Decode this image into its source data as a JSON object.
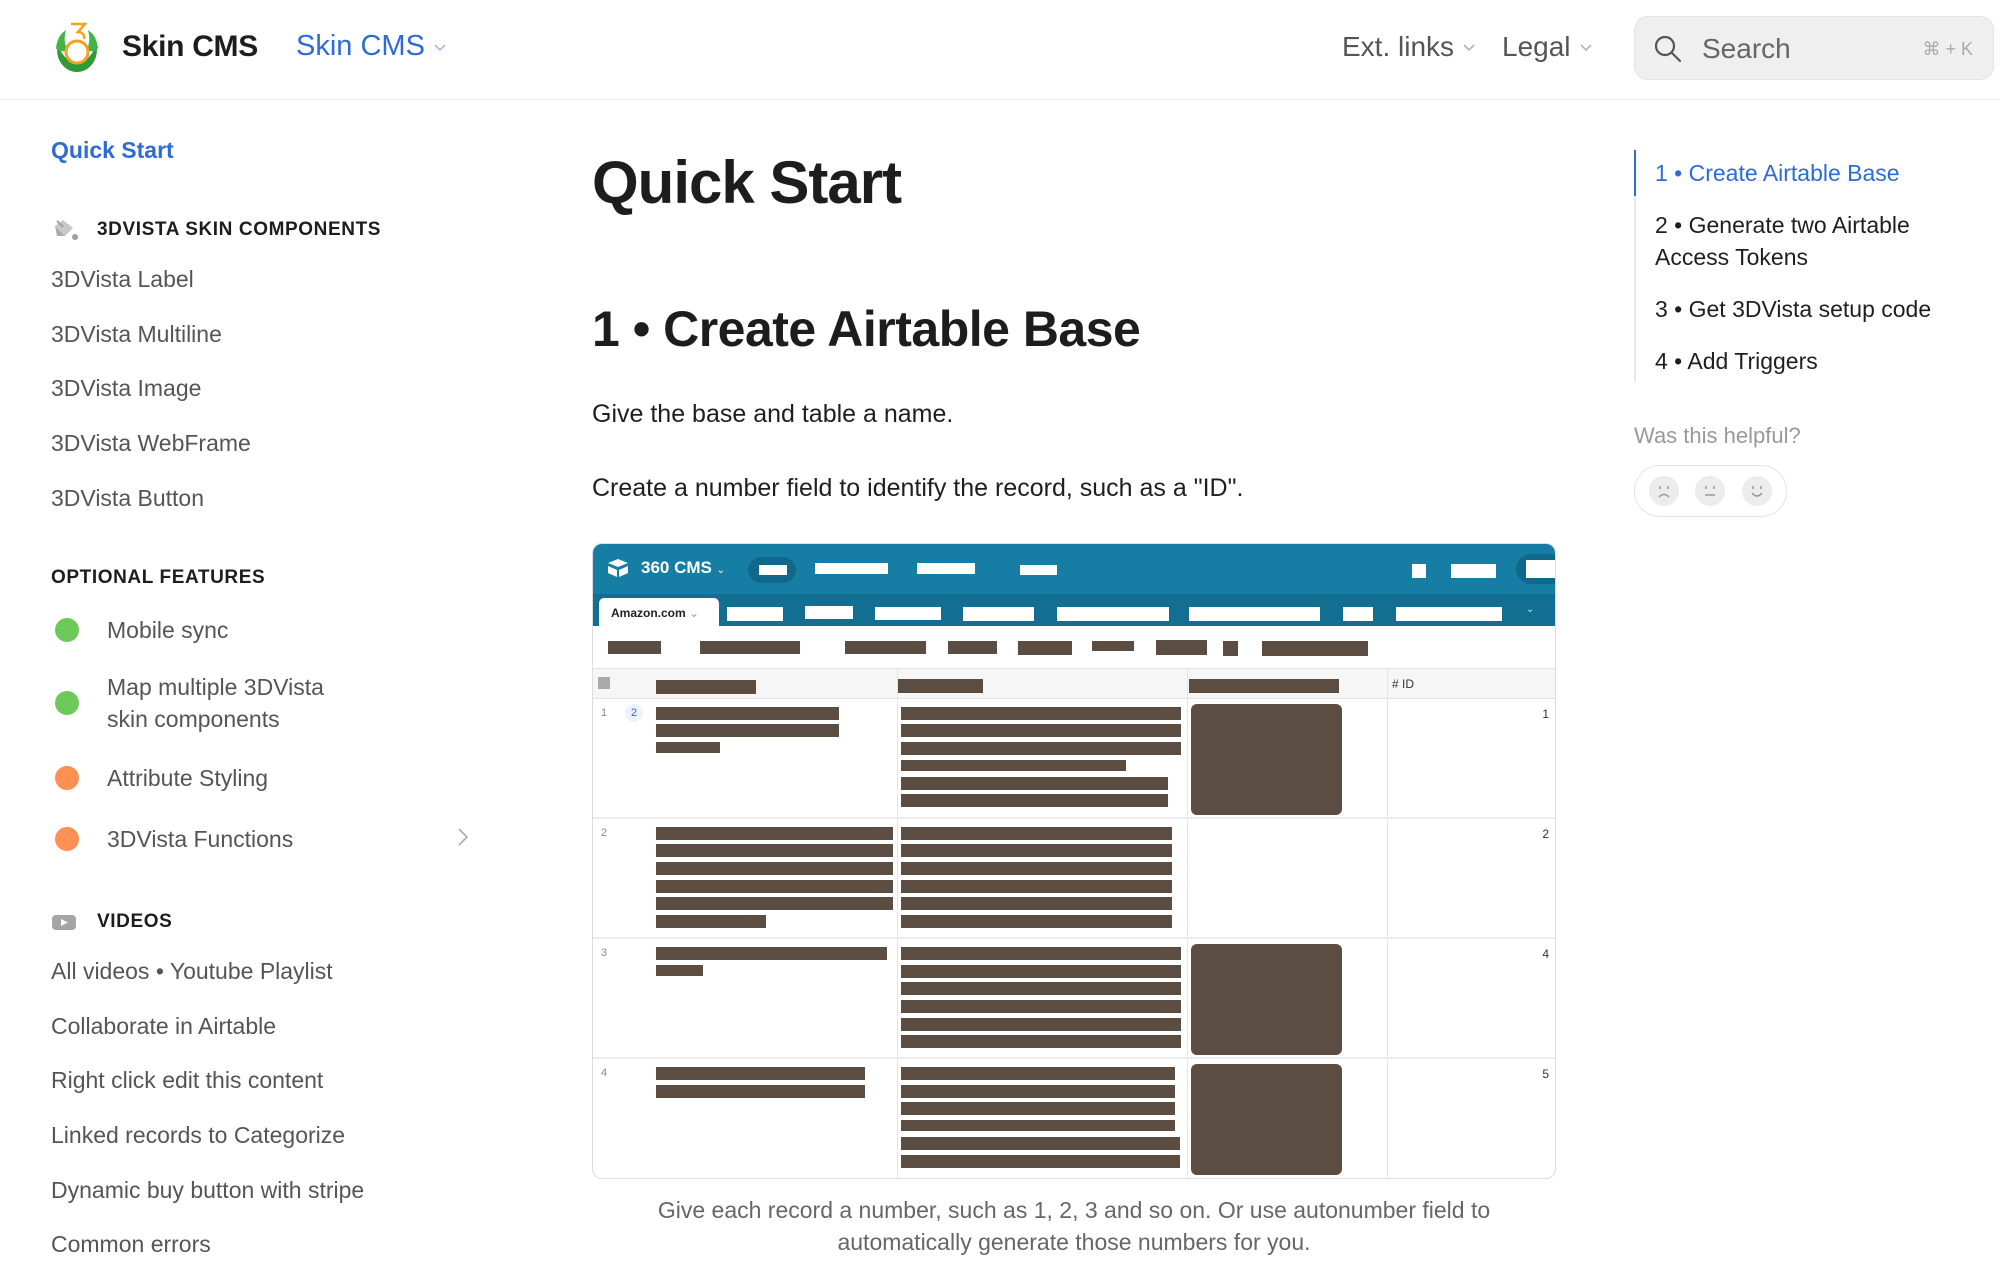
{
  "header": {
    "brand": "Skin CMS",
    "product_switcher": "Skin CMS",
    "nav": [
      {
        "label": "Ext. links"
      },
      {
        "label": "Legal"
      }
    ],
    "search": {
      "placeholder": "Search",
      "shortcut": "⌘ + K"
    }
  },
  "sidebar": {
    "quick_start": "Quick Start",
    "sections": [
      {
        "title": "3DVISTA SKIN COMPONENTS",
        "icon": "paint-bucket-icon",
        "items": [
          "3DVista Label",
          "3DVista Multiline",
          "3DVista Image",
          "3DVista WebFrame",
          "3DVista Button"
        ]
      },
      {
        "title": "OPTIONAL FEATURES",
        "items": [
          {
            "label": "Mobile sync",
            "status_color": "#6dc95a"
          },
          {
            "label": "Map multiple 3DVista",
            "label2": "skin components",
            "status_color": "#6dc95a"
          },
          {
            "label": "Attribute Styling",
            "status_color": "#ff8f52"
          },
          {
            "label": "3DVista Functions",
            "status_color": "#ff8f52",
            "expandable": true
          }
        ]
      },
      {
        "title": "VIDEOS",
        "icon": "video-play-icon",
        "items": [
          "All videos • Youtube Playlist",
          "Collaborate in Airtable",
          "Right click edit this content",
          "Linked records to Categorize",
          "Dynamic buy button with stripe",
          "Common errors"
        ]
      }
    ]
  },
  "main": {
    "title": "Quick Start",
    "section_heading": "1 • Create Airtable Base",
    "paragraphs": [
      "Give the base and table a name.",
      "Create a number field to identify the record, such as a \"ID\"."
    ],
    "screenshot": {
      "base_name": "360 CMS",
      "active_table": "Amazon.com",
      "id_column_label": "# ID",
      "rows": [
        {
          "row": "1",
          "badge": "2",
          "id": "1"
        },
        {
          "row": "2",
          "id": "2"
        },
        {
          "row": "3",
          "id": "4"
        },
        {
          "row": "4",
          "id": "5"
        }
      ]
    },
    "caption_line1": "Give each record a number, such as 1, 2, 3 and so on. Or use autonumber field to",
    "caption_line2": "automatically generate those numbers for you."
  },
  "toc": {
    "items": [
      {
        "label": "1 • Create Airtable Base",
        "active": true
      },
      {
        "label": "2 • Generate two Airtable Access Tokens"
      },
      {
        "label": "3 • Get 3DVista setup code"
      },
      {
        "label": "4 • Add Triggers"
      }
    ],
    "helpful_prompt": "Was this helpful?",
    "feedback": [
      "sad-face-icon",
      "neutral-face-icon",
      "happy-face-icon"
    ]
  },
  "colors": {
    "accent": "#2f6bd8",
    "airtable_header": "#167ea5",
    "redaction": "#5b4d42",
    "status_green": "#6dc95a",
    "status_orange": "#ff8f52"
  }
}
